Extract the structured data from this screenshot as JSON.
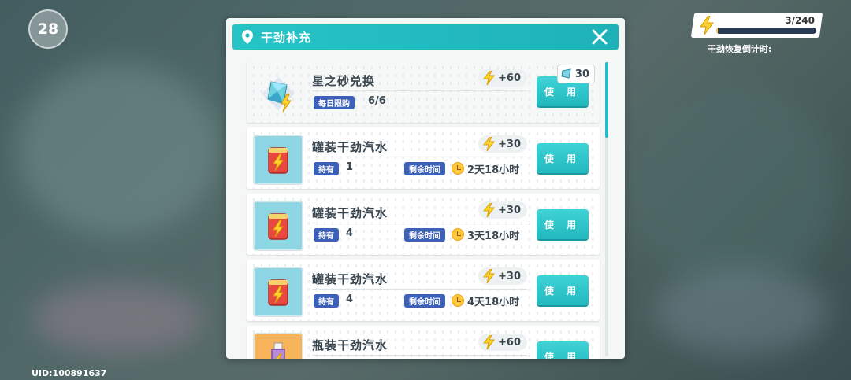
{
  "hud": {
    "level": "28",
    "uid": "UID:100891637",
    "energy_count": "3/240",
    "energy_progress": 0.0125,
    "energy_timer_label": "干劲恢复倒计时:"
  },
  "modal": {
    "title": "干劲补充",
    "items": [
      {
        "name": "星之砂兑换",
        "gain": "+60",
        "tag1": "每日限购",
        "val1": "6/6",
        "cost": "30",
        "button": "使 用"
      },
      {
        "name": "罐装干劲汽水",
        "gain": "+30",
        "tag1": "持有",
        "val1": "1",
        "tag2": "剩余时间",
        "val2": "2天18小时",
        "button": "使 用"
      },
      {
        "name": "罐装干劲汽水",
        "gain": "+30",
        "tag1": "持有",
        "val1": "4",
        "tag2": "剩余时间",
        "val2": "3天18小时",
        "button": "使 用"
      },
      {
        "name": "罐装干劲汽水",
        "gain": "+30",
        "tag1": "持有",
        "val1": "4",
        "tag2": "剩余时间",
        "val2": "4天18小时",
        "button": "使 用"
      },
      {
        "name": "瓶装干劲汽水",
        "gain": "+60",
        "button": "使 用"
      }
    ]
  },
  "colors": {
    "accent": "#27c4c7",
    "tag": "#3d61b8",
    "bolt": "#ffd12e"
  }
}
